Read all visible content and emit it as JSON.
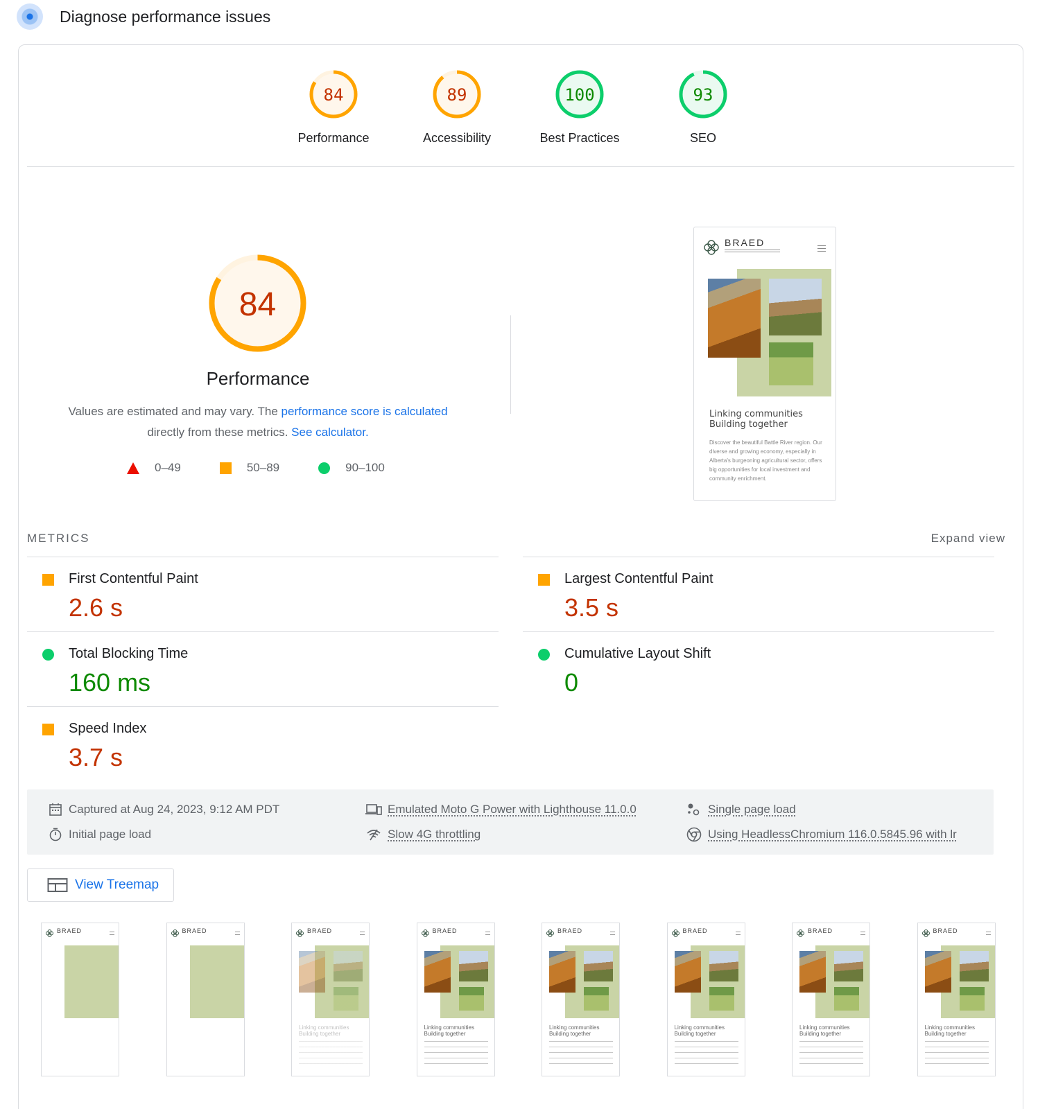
{
  "header": {
    "title": "Diagnose performance issues"
  },
  "scores": [
    {
      "label": "Performance",
      "value": 84,
      "color": "#ffa400",
      "text_color": "#c33300"
    },
    {
      "label": "Accessibility",
      "value": 89,
      "color": "#ffa400",
      "text_color": "#c33300"
    },
    {
      "label": "Best Practices",
      "value": 100,
      "color": "#0cce6b",
      "text_color": "#0d8a00"
    },
    {
      "label": "SEO",
      "value": 93,
      "color": "#0cce6b",
      "text_color": "#0d8a00"
    }
  ],
  "performance": {
    "score": "84",
    "score_value": 84,
    "title": "Performance",
    "desc_prefix": "Values are estimated and may vary. The ",
    "desc_link1": "performance score is calculated",
    "desc_middle": " directly from these metrics. ",
    "desc_link2": "See calculator."
  },
  "legend": [
    {
      "range": "0–49",
      "shape": "triangle",
      "color": "#eb0f00"
    },
    {
      "range": "50–89",
      "shape": "square",
      "color": "#ffa400"
    },
    {
      "range": "90–100",
      "shape": "circle",
      "color": "#0cce6b"
    }
  ],
  "screenshot": {
    "brand": "BRAED",
    "headline1": "Linking communities",
    "headline2": "Building together",
    "body": "Discover the beautiful Battle River region. Our diverse and growing economy, especially in Alberta's burgeoning agricultural sector, offers big opportunities for local investment and community enrichment."
  },
  "metrics_section": {
    "label": "METRICS",
    "expand": "Expand view"
  },
  "metrics": [
    {
      "name": "First Contentful Paint",
      "value": "2.6 s",
      "rating": "average"
    },
    {
      "name": "Largest Contentful Paint",
      "value": "3.5 s",
      "rating": "average"
    },
    {
      "name": "Total Blocking Time",
      "value": "160 ms",
      "rating": "pass"
    },
    {
      "name": "Cumulative Layout Shift",
      "value": "0",
      "rating": "pass"
    },
    {
      "name": "Speed Index",
      "value": "3.7 s",
      "rating": "average"
    }
  ],
  "environment": {
    "captured": "Captured at Aug 24, 2023, 9:12 AM PDT",
    "initial": "Initial page load",
    "device": "Emulated Moto G Power with Lighthouse 11.0.0",
    "throttling": "Slow 4G throttling",
    "session": "Single page load",
    "browser": "Using HeadlessChromium 116.0.5845.96 with lr"
  },
  "treemap": {
    "label": "View Treemap"
  },
  "filmstrip": {
    "brand": "BRAED",
    "headline1": "Linking communities",
    "headline2": "Building together",
    "frames": [
      "blank",
      "blank",
      "faded",
      "full",
      "full",
      "full",
      "full",
      "full"
    ]
  }
}
